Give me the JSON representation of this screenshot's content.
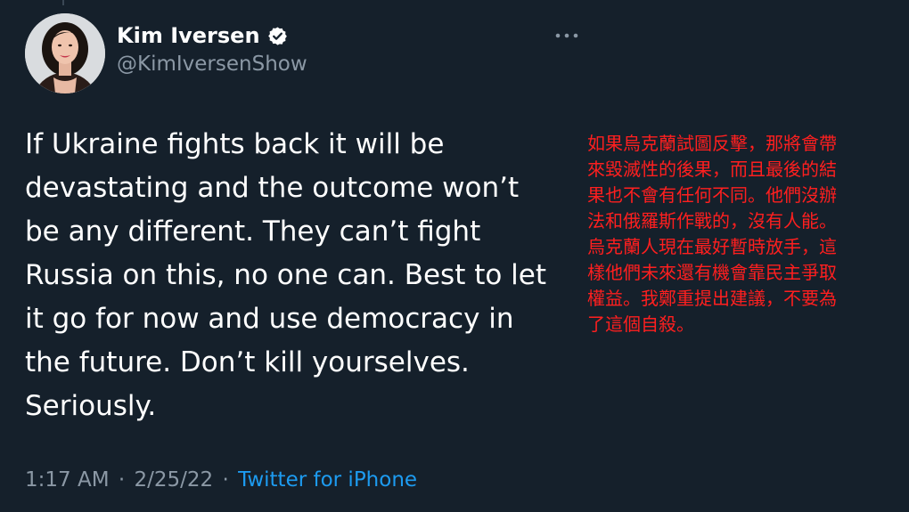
{
  "author": {
    "name": "Kim Iversen",
    "handle": "@KimIversenShow",
    "verified": true,
    "avatar_icon": "profile-photo"
  },
  "tweet": {
    "text": "If Ukraine fights back it will be\ndevastating and the outcome won’t\nbe any different. They can’t fight\nRussia on this, no one can. Best to let\nit go for now and use democracy in\nthe future. Don’t kill yourselves.\nSeriously."
  },
  "translation": {
    "text": "如果烏克蘭試圖反擊，那將會帶\n來毀滅性的後果，而且最後的結\n果也不會有任何不同。他們沒辦\n法和俄羅斯作戰的，沒有人能。\n烏克蘭人現在最好暫時放手，這\n樣他們未來還有機會靠民主爭取\n權益。我鄭重提出建議，不要為\n了這個自殺。",
    "color": "#ff1f1f"
  },
  "meta": {
    "time": "1:17 AM",
    "separator": "·",
    "date": "2/25/22",
    "source": "Twitter for iPhone"
  },
  "colors": {
    "background": "#15202b",
    "secondary_text": "#8b98a5",
    "link": "#1d9bf0",
    "verified_badge": "#ffffff"
  },
  "icons": {
    "verified": "verified-badge-icon",
    "more": "more-options-icon"
  }
}
